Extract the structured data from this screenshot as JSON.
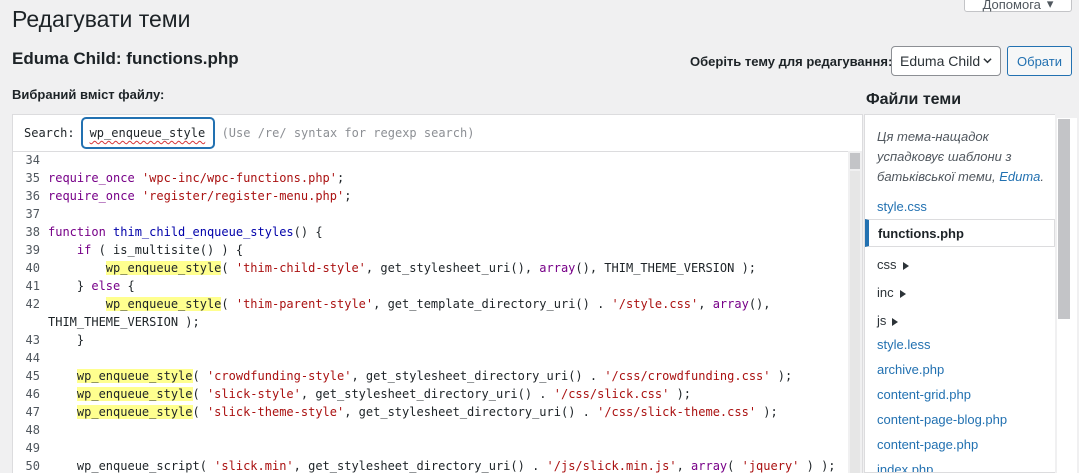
{
  "header": {
    "title": "Редагувати теми",
    "help_label": "Допомога",
    "file_heading": "Eduma Child: functions.php",
    "content_label": "Вибраний вміст файлу:"
  },
  "theme_selector": {
    "label": "Оберіть тему для редагування:",
    "selected": "Eduma Child",
    "button_label": "Обрати"
  },
  "search": {
    "label": "Search:",
    "value": "wp_enqueue_style",
    "hint": "(Use /re/ syntax for regexp search)"
  },
  "code_lines": [
    {
      "n": "34",
      "text": ""
    },
    {
      "n": "35",
      "text": "require_once 'wpc-inc/wpc-functions.php';"
    },
    {
      "n": "36",
      "text": "require_once 'register/register-menu.php';"
    },
    {
      "n": "37",
      "text": ""
    },
    {
      "n": "38",
      "text": "function thim_child_enqueue_styles() {"
    },
    {
      "n": "39",
      "text": "    if ( is_multisite() ) {"
    },
    {
      "n": "40",
      "text": "        wp_enqueue_style( 'thim-child-style', get_stylesheet_uri(), array(), THIM_THEME_VERSION );"
    },
    {
      "n": "41",
      "text": "    } else {"
    },
    {
      "n": "42",
      "text": "        wp_enqueue_style( 'thim-parent-style', get_template_directory_uri() . '/style.css', array(),"
    },
    {
      "n": "",
      "text": "THIM_THEME_VERSION );"
    },
    {
      "n": "43",
      "text": "    }"
    },
    {
      "n": "44",
      "text": ""
    },
    {
      "n": "45",
      "text": "    wp_enqueue_style( 'crowdfunding-style', get_stylesheet_directory_uri() . '/css/crowdfunding.css' );"
    },
    {
      "n": "46",
      "text": "    wp_enqueue_style( 'slick-style', get_stylesheet_directory_uri() . '/css/slick.css' );"
    },
    {
      "n": "47",
      "text": "    wp_enqueue_style( 'slick-theme-style', get_stylesheet_directory_uri() . '/css/slick-theme.css' );"
    },
    {
      "n": "48",
      "text": ""
    },
    {
      "n": "49",
      "text": ""
    },
    {
      "n": "50",
      "text": "    wp_enqueue_script( 'slick.min', get_stylesheet_directory_uri() . '/js/slick.min.js', array( 'jquery' ) );"
    }
  ],
  "files_panel": {
    "heading": "Файли теми",
    "note_prefix": "Ця тема-нащадок успадковує шаблони з батьківської теми, ",
    "note_link": "Eduma",
    "note_suffix": ".",
    "items": [
      {
        "label": "style.css",
        "type": "file"
      },
      {
        "label": "functions.php",
        "type": "current"
      },
      {
        "label": "css",
        "type": "folder"
      },
      {
        "label": "inc",
        "type": "folder"
      },
      {
        "label": "js",
        "type": "folder"
      },
      {
        "label": "style.less",
        "type": "file"
      },
      {
        "label": "archive.php",
        "type": "file"
      },
      {
        "label": "content-grid.php",
        "type": "file"
      },
      {
        "label": "content-page-blog.php",
        "type": "file"
      },
      {
        "label": "content-page.php",
        "type": "file"
      },
      {
        "label": "index.php",
        "type": "file"
      }
    ]
  },
  "colors": {
    "accent": "#2271b1",
    "highlight": "#ffff8f",
    "string": "#aa1111",
    "keyword": "#770088"
  }
}
